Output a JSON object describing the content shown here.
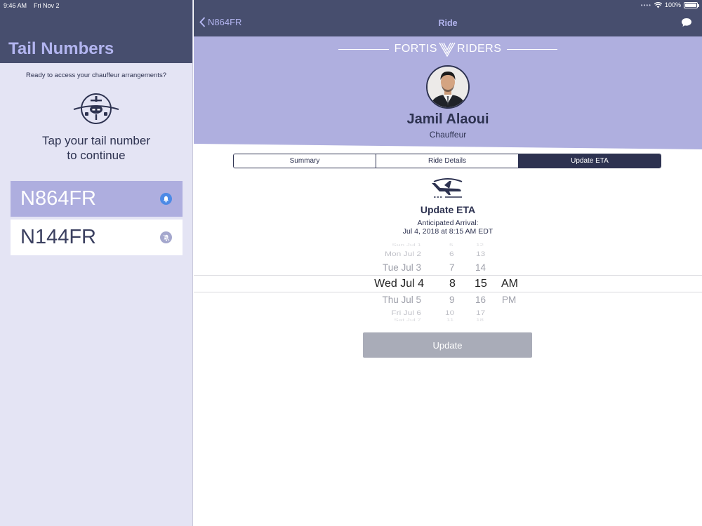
{
  "status_bar": {
    "time": "9:46 AM",
    "date": "Fri Nov 2",
    "battery": "100%"
  },
  "sidebar": {
    "title": "Tail Numbers",
    "intro": "Ready to access your chauffeur arrangements?",
    "tap_line1": "Tap your tail number",
    "tap_line2": "to continue",
    "items": [
      {
        "label": "N864FR",
        "selected": true,
        "notifications": "on"
      },
      {
        "label": "N144FR",
        "selected": false,
        "notifications": "off"
      }
    ]
  },
  "nav": {
    "back_label": "N864FR",
    "title": "Ride"
  },
  "brand": {
    "left": "FORTIS",
    "right": "RIDERS"
  },
  "driver": {
    "name": "Jamil Alaoui",
    "role": "Chauffeur"
  },
  "tabs": [
    {
      "label": "Summary",
      "active": false
    },
    {
      "label": "Ride Details",
      "active": false
    },
    {
      "label": "Update ETA",
      "active": true
    }
  ],
  "eta": {
    "title": "Update ETA",
    "subtitle_line1": "Anticipated Arrival:",
    "subtitle_line2": "Jul 4, 2018 at 8:15 AM EDT"
  },
  "picker": {
    "dates": [
      "Sun Jul 1",
      "Mon Jul 2",
      "Tue Jul 3",
      "Wed Jul 4",
      "Thu Jul 5",
      "Fri Jul 6",
      "Sat Jul 7"
    ],
    "hours": [
      "5",
      "6",
      "7",
      "8",
      "9",
      "10",
      "11"
    ],
    "minutes": [
      "12",
      "13",
      "14",
      "15",
      "16",
      "17",
      "18"
    ],
    "periods": [
      "AM",
      "PM"
    ],
    "selected": {
      "date": "Wed Jul 4",
      "hour": "8",
      "minute": "15",
      "period": "AM"
    }
  },
  "update_button": {
    "label": "Update"
  },
  "colors": {
    "header": "#474e6e",
    "accent_lavender": "#b3b5f0",
    "hero_bg": "#afafdf",
    "sidebar_bg": "#e4e4f4",
    "navy": "#2d3250",
    "bell_on": "#4c8ae6",
    "button_disabled": "#a9acb8"
  }
}
